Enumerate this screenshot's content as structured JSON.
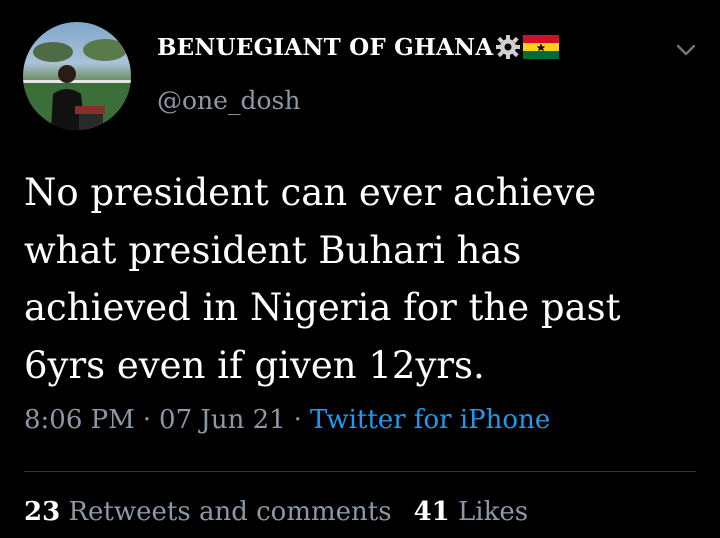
{
  "author": {
    "display_name": "BENUEGIANT OF GHANA",
    "handle": "@one_dosh",
    "badges": [
      "gear-icon",
      "ghana-flag-icon"
    ]
  },
  "tweet": {
    "lines": [
      "No president can ever achieve",
      "what president Buhari has",
      "achieved in Nigeria for the past",
      "6yrs even if given 12yrs."
    ]
  },
  "meta": {
    "time": "8:06 PM",
    "date": "07 Jun 21",
    "separator": "·",
    "source": "Twitter for iPhone"
  },
  "stats": {
    "retweets_count": "23",
    "retweets_label": "Retweets and comments",
    "likes_count": "41",
    "likes_label": "Likes"
  },
  "colors": {
    "background": "#000000",
    "text": "#ffffff",
    "secondary": "#8b98a5",
    "accent": "#1d9bf0",
    "divider": "#2f3336"
  }
}
